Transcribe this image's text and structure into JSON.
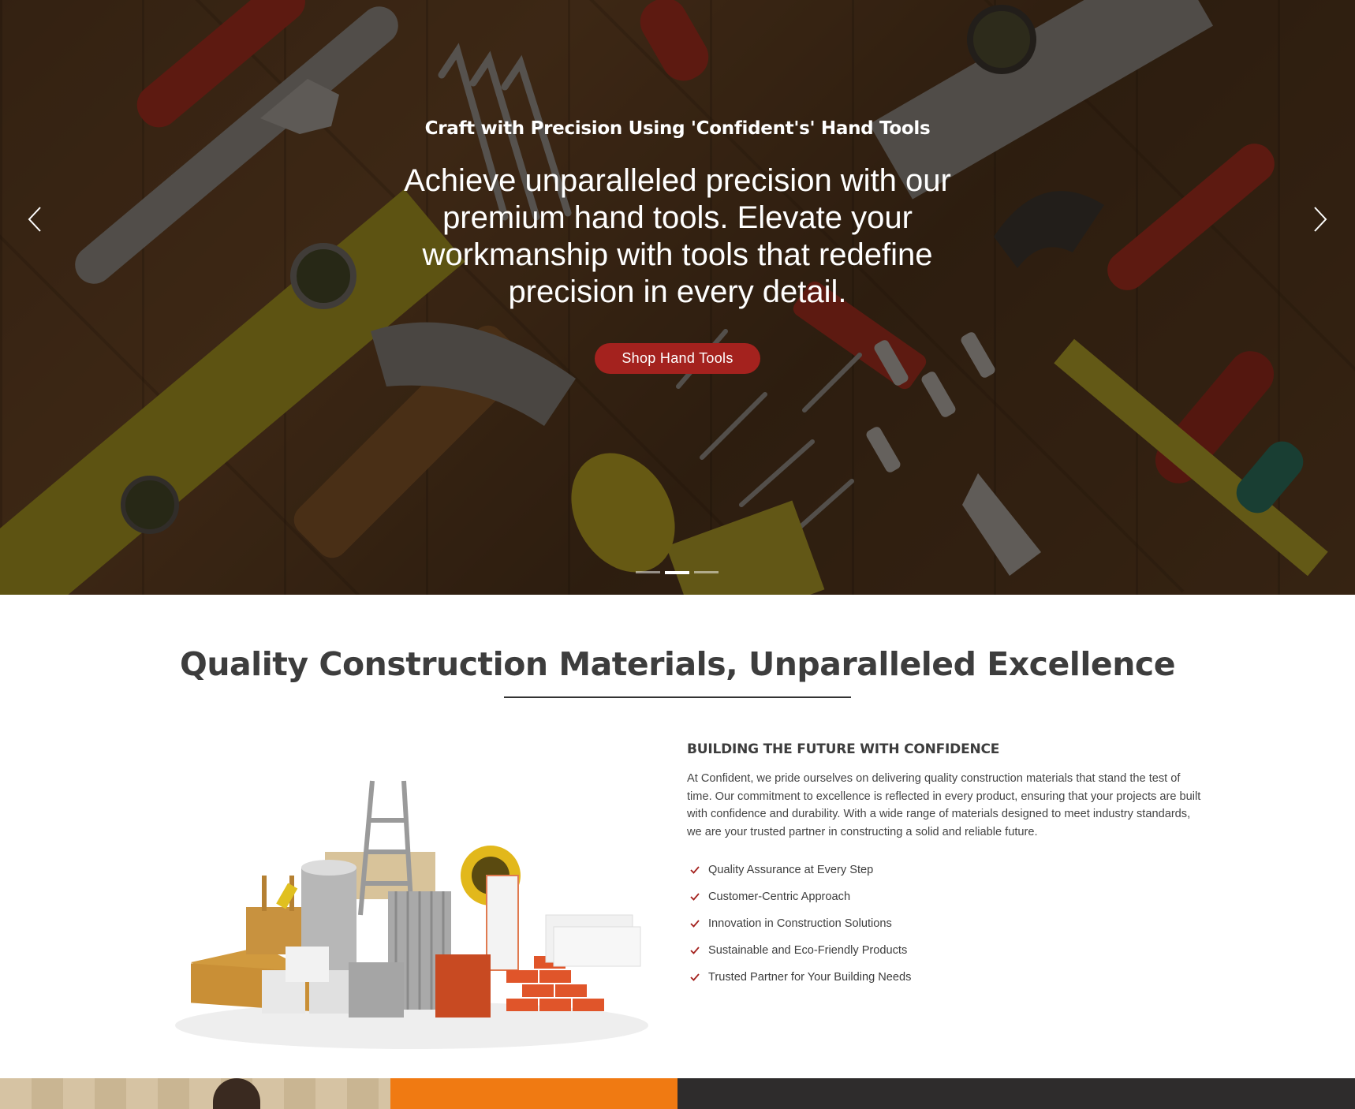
{
  "hero": {
    "subtitle": "Craft with Precision Using 'Confident's' Hand Tools",
    "heading": "Achieve unparalleled precision with our premium hand tools. Elevate your workmanship with tools that redefine precision in every detail.",
    "button_label": "Shop Hand Tools",
    "prev_icon": "chevron-left-icon",
    "next_icon": "chevron-right-icon",
    "slide_count": 3,
    "active_slide": 2,
    "accent_color": "#a4221e"
  },
  "about": {
    "section_title": "Quality Construction Materials, Unparalleled Excellence",
    "heading": "BUILDING THE FUTURE WITH CONFIDENCE",
    "text": "At Confident, we pride ourselves on delivering quality construction materials that stand the test of time. Our commitment to excellence is reflected in every product, ensuring that your projects are built with confidence and durability. With a wide range of materials designed to meet industry standards, we are your trusted partner in constructing a solid and reliable future.",
    "features": [
      "Quality Assurance at Every Step",
      "Customer-Centric Approach",
      "Innovation in Construction Solutions",
      "Sustainable and Eco-Friendly Products",
      "Trusted Partner for Your Building Needs"
    ],
    "check_icon": "checkmark-icon",
    "check_color": "#a4221e"
  },
  "strip": {
    "colors": [
      "#d6c3a3",
      "#f07a12",
      "#2e2c2c"
    ]
  }
}
